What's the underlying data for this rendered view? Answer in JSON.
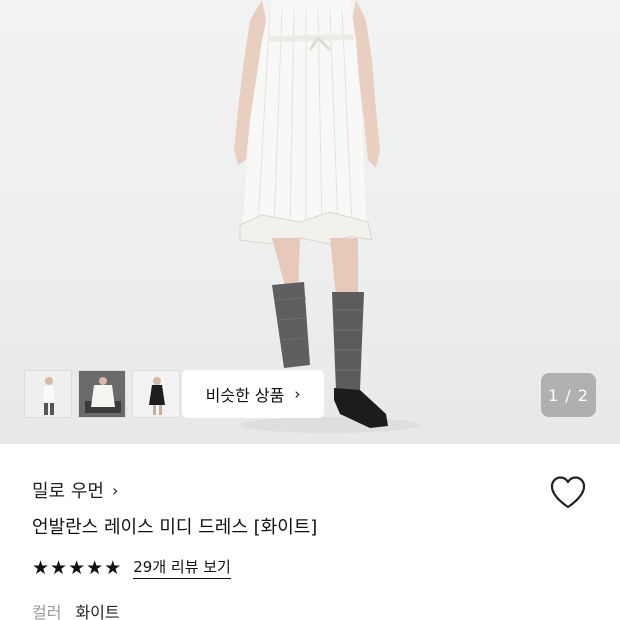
{
  "gallery": {
    "similar_button_label": "비슷한 상품",
    "similar_button_chevron": "›",
    "page_indicator": "1 / 2",
    "thumbnails": [
      "thumbnail-1",
      "thumbnail-2",
      "thumbnail-3"
    ]
  },
  "product": {
    "brand": "밀로 우먼",
    "brand_chevron": "›",
    "title": "언발란스 레이스 미디 드레스 [화이트]",
    "rating_stars": 5,
    "review_link": "29개 리뷰 보기",
    "option_label": "컬러",
    "option_value": "화이트",
    "wishlist_icon": "heart-outline-icon"
  },
  "colors": {
    "star": "#111111",
    "pager_bg": "#8a8a8a"
  }
}
